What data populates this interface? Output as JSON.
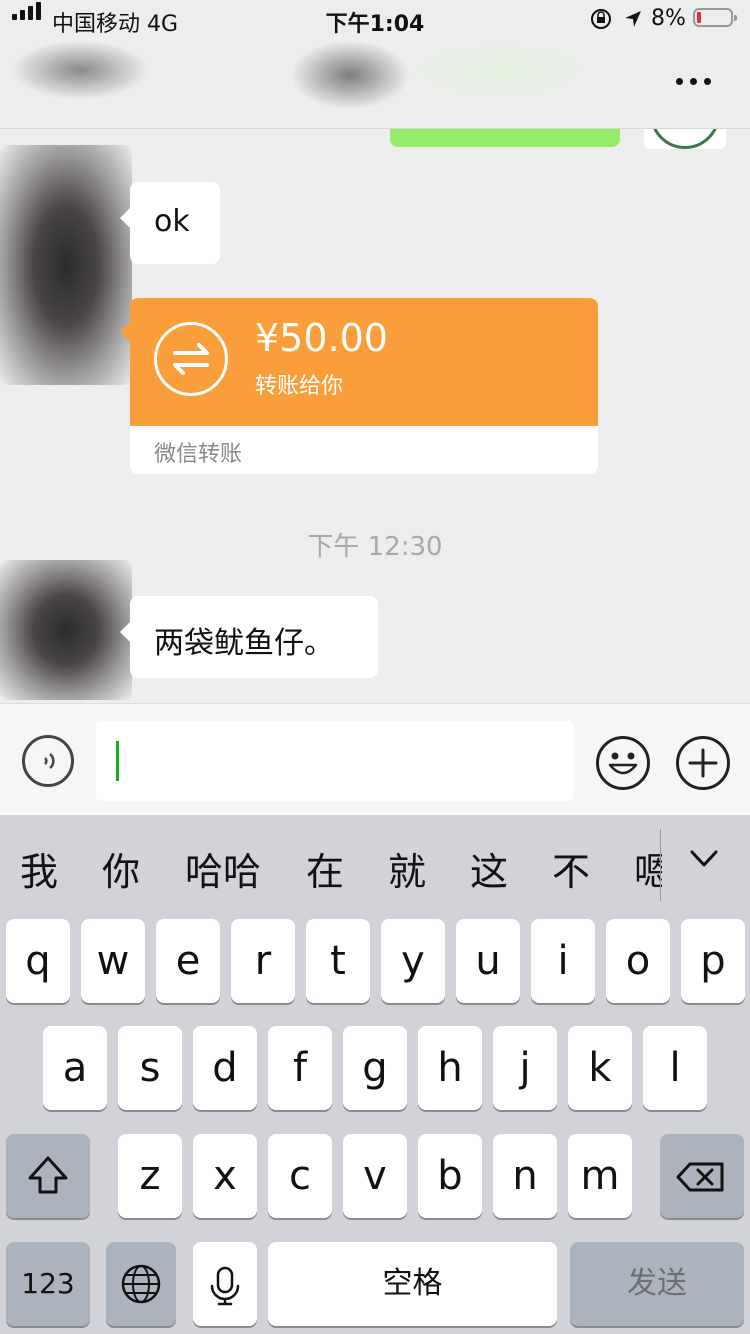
{
  "status_bar": {
    "carrier": "中国移动 4G",
    "time": "下午1:04",
    "battery_percent": "8%",
    "icons": [
      "signal-icon",
      "orientation-lock-icon",
      "location-arrow-icon",
      "battery-icon"
    ]
  },
  "nav": {
    "more_icon": "more-dots-icon"
  },
  "messages": [
    {
      "type": "text",
      "text": "ok"
    },
    {
      "type": "transfer",
      "amount": "¥50.00",
      "subtitle": "转账给你",
      "footer": "微信转账"
    },
    {
      "type": "timestamp",
      "text": "下午 12:30"
    },
    {
      "type": "text",
      "text": "两袋鱿鱼仔。"
    }
  ],
  "input_bar": {
    "value": "",
    "icons": [
      "voice-icon",
      "emoji-icon",
      "plus-icon"
    ]
  },
  "keyboard": {
    "candidates": [
      "我",
      "你",
      "哈哈",
      "在",
      "就",
      "这",
      "不",
      "嗯"
    ],
    "row1": [
      "q",
      "w",
      "e",
      "r",
      "t",
      "y",
      "u",
      "i",
      "o",
      "p"
    ],
    "row2": [
      "a",
      "s",
      "d",
      "f",
      "g",
      "h",
      "j",
      "k",
      "l"
    ],
    "row3": [
      "z",
      "x",
      "c",
      "v",
      "b",
      "n",
      "m"
    ],
    "numbers_key": "123",
    "space_key": "空格",
    "send_key": "发送"
  },
  "colors": {
    "transfer_orange": "#fa9d3b",
    "sent_bubble_green": "#95ec69",
    "caret_green": "#1aad19"
  }
}
